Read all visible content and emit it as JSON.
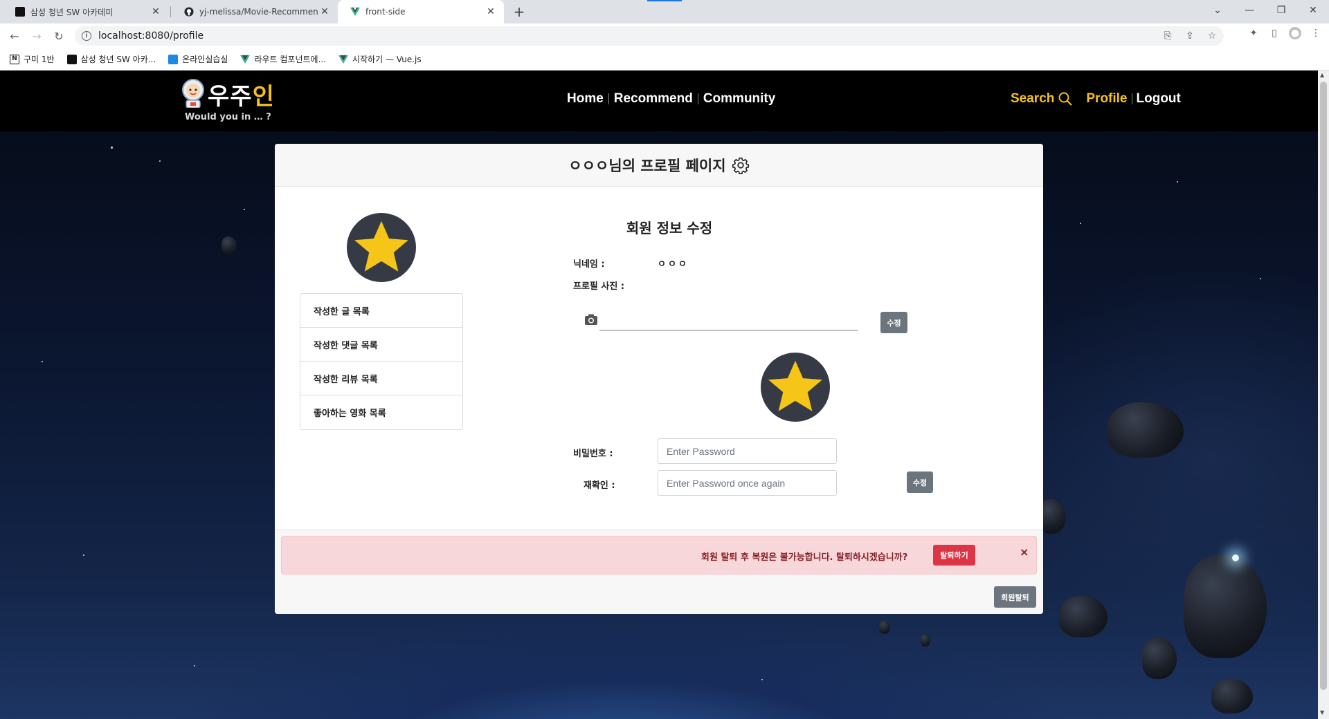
{
  "browser": {
    "tabs": [
      {
        "title": "삼성 청년 SW 아카데미",
        "active": false
      },
      {
        "title": "yj-melissa/Movie-Recommend-T",
        "active": false
      },
      {
        "title": "front-side",
        "active": true
      }
    ],
    "url": "localhost:8080/profile",
    "bookmarks": [
      {
        "label": "구미 1반"
      },
      {
        "label": "삼성 청년 SW 아카..."
      },
      {
        "label": "온라인실습실"
      },
      {
        "label": "라우트 컴포넌트에..."
      },
      {
        "label": "시작하기 — Vue.js"
      }
    ]
  },
  "site": {
    "logo_main": "우주",
    "logo_accent": "인",
    "logo_sub": "Would you in … ?",
    "nav": {
      "home": "Home",
      "recommend": "Recommend",
      "community": "Community"
    },
    "right_nav": {
      "search": "Search",
      "profile": "Profile",
      "logout": "Logout"
    },
    "brand_color": "#f7c11b"
  },
  "profile": {
    "header_title": "ㅇㅇㅇ님의 프로필 페이지",
    "menu": [
      "작성한 글 목록",
      "작성한 댓글 목록",
      "작성한 리뷰 목록",
      "좋아하는 영화 목록"
    ],
    "edit_title": "회원 정보 수정",
    "nickname_label": "닉네임 :",
    "nickname_value": "ㅇㅇㅇ",
    "photo_label": "프로필 사진 :",
    "photo_submit": "수정",
    "password_label": "비밀번호 :",
    "password_placeholder": "Enter Password",
    "confirm_label": "재확인 :",
    "confirm_placeholder": "Enter Password once again",
    "password_submit": "수정"
  },
  "withdraw": {
    "alert_text": "회원 탈퇴 후 복원은 불가능합니다. 탈퇴하시겠습니까?",
    "confirm_button": "탈퇴하기",
    "close_symbol": "×",
    "button": "회원탈퇴"
  }
}
